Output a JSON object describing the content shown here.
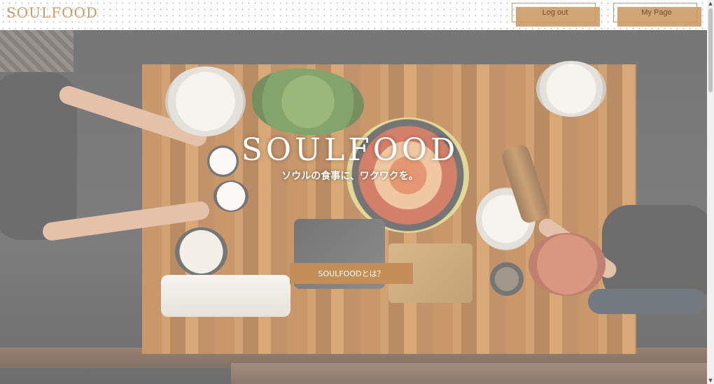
{
  "header": {
    "logo": "SOULFOOD",
    "logout_label": "Log out",
    "mypage_label": "My Page"
  },
  "hero": {
    "title": "SOULFOOD",
    "subtitle": "ソウルの食事に、ワクワクを。",
    "cta_label": "SOULFOODとは？"
  },
  "colors": {
    "accent": "#d2a574",
    "accent_dark": "#c38e58",
    "logo": "#c99a66"
  },
  "icons": {
    "scroll_up": "scroll-up-arrow-icon",
    "scroll_down": "scroll-down-arrow-icon"
  }
}
